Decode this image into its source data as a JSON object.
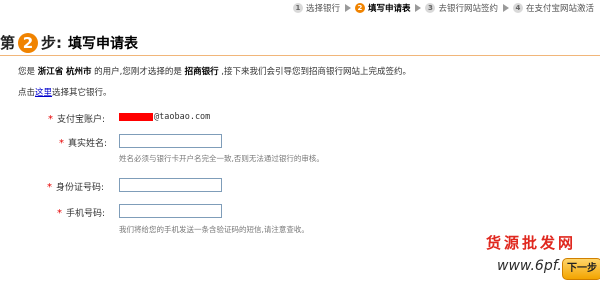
{
  "steps": [
    {
      "num": "1",
      "label": "选择银行"
    },
    {
      "num": "2",
      "label": "填写申请表"
    },
    {
      "num": "3",
      "label": "去银行网站签约"
    },
    {
      "num": "4",
      "label": "在支付宝网站激活"
    }
  ],
  "heading": {
    "pre": "第",
    "num": "2",
    "post": "步:",
    "title": "填写申请表"
  },
  "intro": {
    "t1": "您是",
    "province": "浙江省",
    "city": "杭州市",
    "t2": "的用户,您刚才选择的是",
    "bank": "招商银行",
    "t3": ",接下来我们会引导您到招商银行网站上完成签约。"
  },
  "change_bank": {
    "t1": "点击",
    "link": "这里",
    "t2": "选择其它银行。"
  },
  "form": {
    "account": {
      "label": "支付宝账户:",
      "email_suffix": "@taobao.com"
    },
    "realname": {
      "label": "真实姓名:",
      "hint": "姓名必须与银行卡开户名完全一致,否则无法通过银行的审核。"
    },
    "idcard": {
      "label": "身份证号码:"
    },
    "phone": {
      "label": "手机号码:",
      "hint": "我们将给您的手机发送一条含验证码的短信,请注意查收。"
    }
  },
  "watermark": {
    "text": "货源批发网",
    "url": "www.6pf.com"
  },
  "submit": {
    "label": "下一步"
  }
}
